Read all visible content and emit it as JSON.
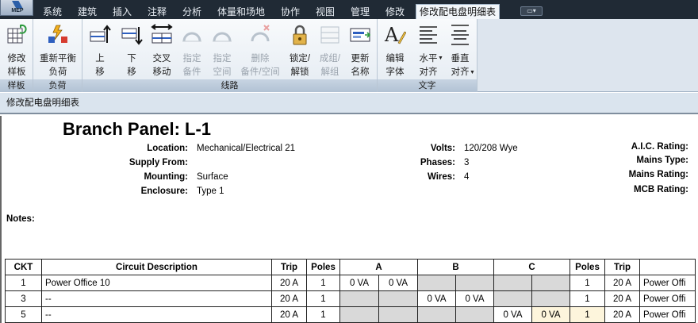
{
  "app": {
    "logo_label": "MEP"
  },
  "tabs": [
    {
      "label": "系统",
      "active": false
    },
    {
      "label": "建筑",
      "active": false
    },
    {
      "label": "插入",
      "active": false
    },
    {
      "label": "注释",
      "active": false
    },
    {
      "label": "分析",
      "active": false
    },
    {
      "label": "体量和场地",
      "active": false
    },
    {
      "label": "协作",
      "active": false
    },
    {
      "label": "视图",
      "active": false
    },
    {
      "label": "管理",
      "active": false
    },
    {
      "label": "修改",
      "active": false
    },
    {
      "label": "修改配电盘明细表",
      "active": true
    }
  ],
  "ribbon": {
    "panels": {
      "template": "样板",
      "load": "负荷",
      "circuits": "线路",
      "text": "文字"
    },
    "buttons": {
      "modify_template": "修改\n样板",
      "rebalance": "重新平衡\n负荷",
      "move_up": "上\n移",
      "move_down": "下\n移",
      "cross_move": "交叉\n移动",
      "assign_spare": "指定\n备件",
      "assign_space": "指定\n空间",
      "delete_spare": "删除\n备件/空间",
      "lock_unlock": "锁定/\n解锁",
      "group_ungroup": "成组/\n解组",
      "update_name": "更新\n名称",
      "edit_font": "编辑\n字体",
      "h_align": "水平\n对齐",
      "v_align": "垂直\n对齐"
    }
  },
  "context_label": "修改配电盘明细表",
  "schedule": {
    "title": "Branch Panel: L-1",
    "fields_left": [
      {
        "label": "Location:",
        "value": "Mechanical/Electrical 21"
      },
      {
        "label": "Supply From:",
        "value": ""
      },
      {
        "label": "Mounting:",
        "value": "Surface"
      },
      {
        "label": "Enclosure:",
        "value": "Type 1"
      }
    ],
    "fields_mid": [
      {
        "label": "Volts:",
        "value": "120/208 Wye"
      },
      {
        "label": "Phases:",
        "value": "3"
      },
      {
        "label": "Wires:",
        "value": "4"
      }
    ],
    "fields_right": [
      {
        "label": "A.I.C. Rating:"
      },
      {
        "label": "Mains Type:"
      },
      {
        "label": "Mains Rating:"
      },
      {
        "label": "MCB Rating:"
      }
    ],
    "notes_label": "Notes:",
    "columns": [
      "CKT",
      "Circuit Description",
      "Trip",
      "Poles",
      "A",
      "B",
      "C",
      "Poles",
      "Trip",
      ""
    ],
    "rows": [
      {
        "ckt": "1",
        "desc": "Power Office 10",
        "trip": "20 A",
        "poles": "1",
        "a1": "0 VA",
        "a2": "0 VA",
        "b1": "",
        "b2": "",
        "c1": "",
        "c2": "",
        "poles_r": "1",
        "trip_r": "20 A",
        "desc_r": "Power Offi",
        "phase": "A"
      },
      {
        "ckt": "3",
        "desc": "--",
        "trip": "20 A",
        "poles": "1",
        "a1": "",
        "a2": "",
        "b1": "0 VA",
        "b2": "0 VA",
        "c1": "",
        "c2": "",
        "poles_r": "1",
        "trip_r": "20 A",
        "desc_r": "Power Offi",
        "phase": "B"
      },
      {
        "ckt": "5",
        "desc": "--",
        "trip": "20 A",
        "poles": "1",
        "a1": "",
        "a2": "",
        "b1": "",
        "b2": "",
        "c1": "0 VA",
        "c2": "0 VA",
        "poles_r": "1",
        "trip_r": "20 A",
        "desc_r": "Power Offi",
        "phase": "C"
      }
    ]
  }
}
